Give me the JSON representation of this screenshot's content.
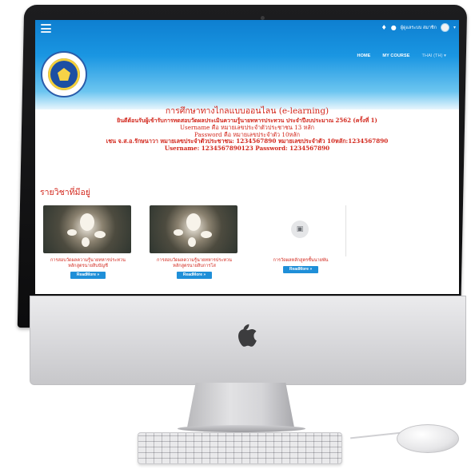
{
  "topbar": {
    "menu_icon": "hamburger-menu-icon",
    "user_name": "ผู้ดูแลระบบ สมาชิก",
    "caret": "▾"
  },
  "nav": {
    "home": "HOME",
    "my_course": "MY COURSE",
    "language": "THAI (TH) ▾"
  },
  "intro": {
    "title": "การศึกษาทางไกลแบบออนไลน (e-learning)",
    "subtitle": "ยินดีต้อนรับผู้เข้ารับการทดสอบวัดผลประเมินความรู้นายทหารประทวน ประจำปีงบประมาณ 2562 (ครั้งที่ 1)",
    "username_rule": "Username คือ หมายเลขประจำตัวประชาชน 13 หลัก",
    "password_rule": "Password คือ หมายเลขประจำตัว 10หลัก",
    "example": "เชน จ.ส.อ.รักษนาวา หมายเลขประจำตัวประชาชน: 1234567890 หมายเลขประจำตัว 10หลัก:1234567890",
    "credentials": "Username: 1234567890123     Password: 1234567890"
  },
  "courses_section": {
    "title": "รายวิชาที่มีอยู่",
    "items": [
      {
        "name": "การสอบวัดผลความรู้นายทหารประทวนหลักสูตรนายสิบบัญชี",
        "button": "ReadMore »"
      },
      {
        "name": "การสอบวัดผลความรู้นายทหารประทวนหลักสูตรนายสิบการโส",
        "button": "ReadMore »"
      },
      {
        "name": "การวัดผลหลักสูตรชั้นนายพัน",
        "button": "ReadMore »"
      }
    ]
  },
  "colors": {
    "header_blue": "#1a96e2",
    "accent_red": "#d2261b",
    "button_blue": "#1f8fd8"
  }
}
